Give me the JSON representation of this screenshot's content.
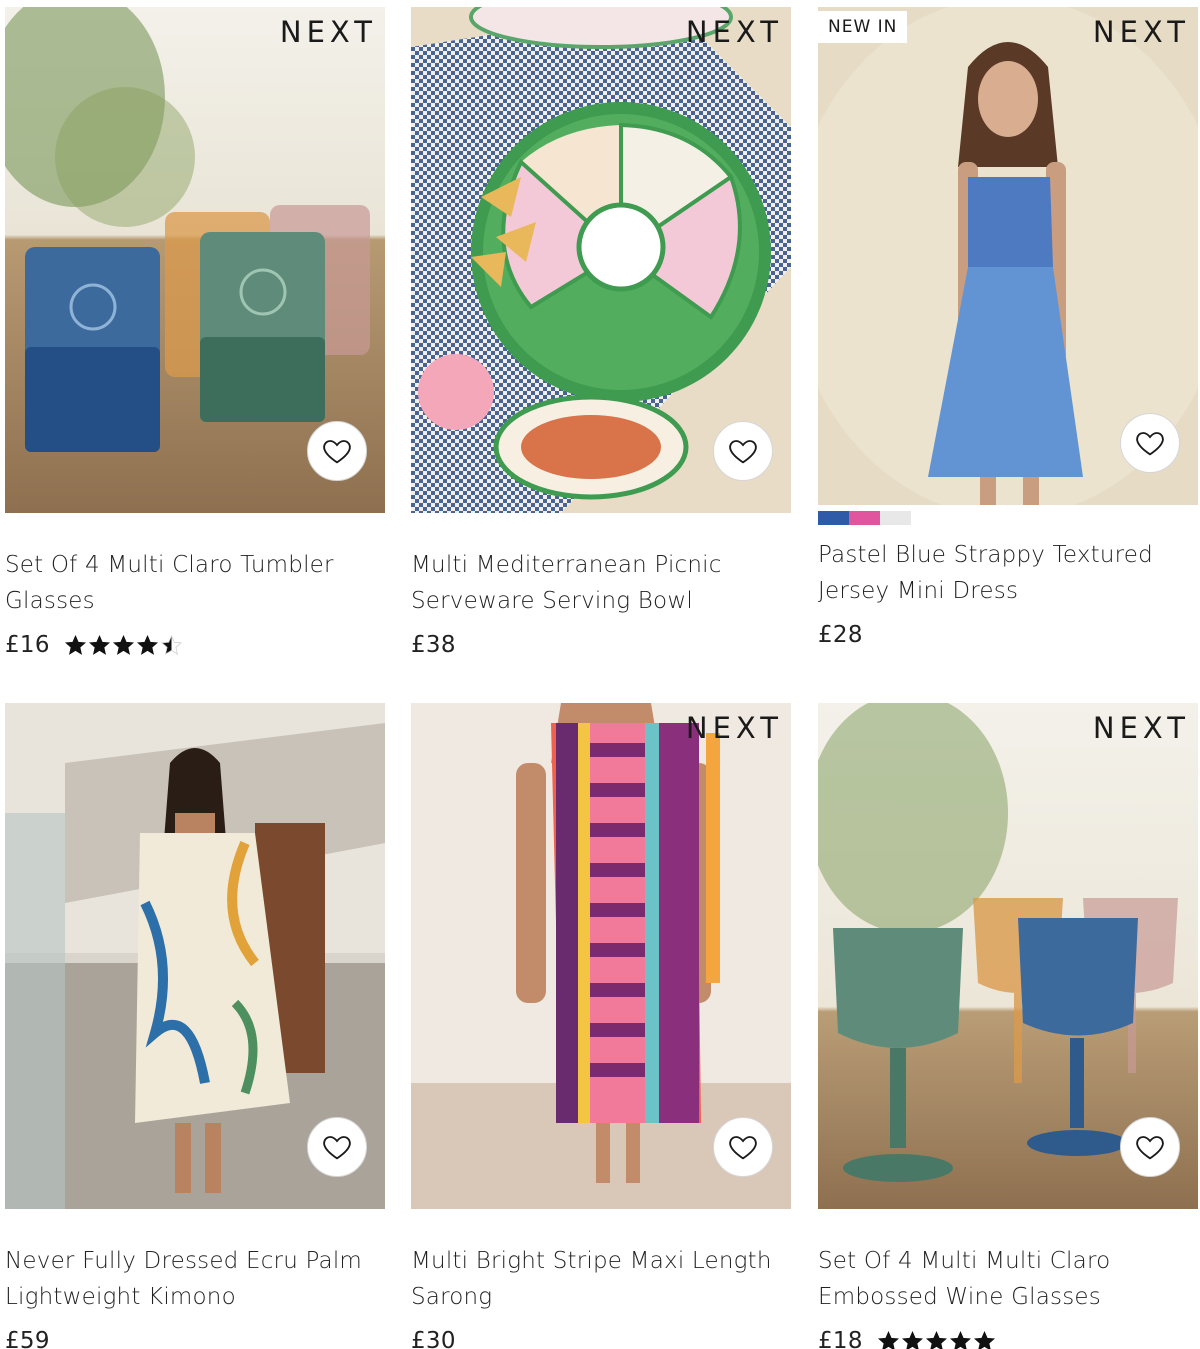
{
  "products": [
    {
      "title": "Set Of 4 Multi Claro Tumbler Glasses",
      "price": "£16",
      "brand": "NEXT",
      "badge": "",
      "rating": 4.5,
      "favourite_icon": "heart-outline-icon"
    },
    {
      "title": "Multi Mediterranean Picnic Serveware Serving Bowl",
      "price": "£38",
      "brand": "NEXT",
      "badge": "",
      "favourite_icon": "heart-outline-icon"
    },
    {
      "title": "Pastel Blue Strappy Textured Jersey Mini Dress",
      "price": "£28",
      "brand": "NEXT",
      "badge": "NEW IN",
      "swatches": [
        "#2f5aa8",
        "#e0559e",
        "#e8e8e8"
      ],
      "favourite_icon": "heart-outline-icon"
    },
    {
      "title": "Never Fully Dressed Ecru Palm Lightweight Kimono",
      "price": "£59",
      "brand": "",
      "badge": "",
      "favourite_icon": "heart-outline-icon"
    },
    {
      "title": "Multi Bright Stripe Maxi Length Sarong",
      "price": "£30",
      "brand": "NEXT",
      "badge": "",
      "favourite_icon": "heart-outline-icon"
    },
    {
      "title": "Set Of 4 Multi Multi Claro Embossed Wine Glasses",
      "price": "£18",
      "brand": "NEXT",
      "badge": "",
      "rating": 5,
      "favourite_icon": "heart-outline-icon"
    }
  ],
  "colors": {
    "text": "#222222",
    "star": "#111111",
    "heart_stroke": "#1a1a1a"
  }
}
